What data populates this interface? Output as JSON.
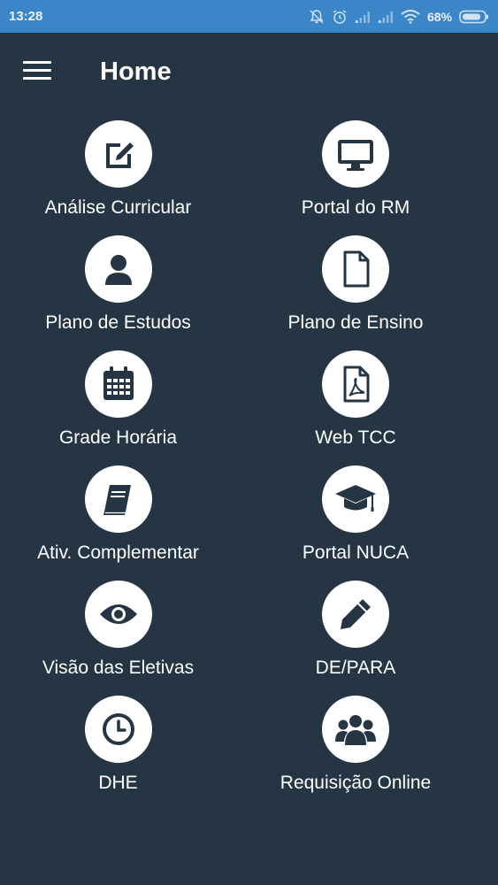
{
  "status_bar": {
    "time": "13:28",
    "battery": "68%",
    "icons": [
      "mute-bell-icon",
      "alarm-icon",
      "signal-icon",
      "signal-icon",
      "wifi-icon",
      "battery-icon"
    ]
  },
  "header": {
    "title": "Home",
    "menu_icon": "hamburger-menu-icon"
  },
  "menu_items": [
    {
      "label": "Análise Curricular",
      "icon": "edit-square-icon"
    },
    {
      "label": "Portal do RM",
      "icon": "desktop-monitor-icon"
    },
    {
      "label": "Plano de Estudos",
      "icon": "user-icon"
    },
    {
      "label": "Plano de Ensino",
      "icon": "document-icon"
    },
    {
      "label": "Grade Horária",
      "icon": "calendar-icon"
    },
    {
      "label": "Web TCC",
      "icon": "pdf-file-icon"
    },
    {
      "label": "Ativ. Complementar",
      "icon": "book-icon"
    },
    {
      "label": "Portal NUCA",
      "icon": "graduation-cap-icon"
    },
    {
      "label": "Visão das Eletivas",
      "icon": "eye-icon"
    },
    {
      "label": "DE/PARA",
      "icon": "pencil-icon"
    },
    {
      "label": "DHE",
      "icon": "clock-icon"
    },
    {
      "label": "Requisição Online",
      "icon": "users-group-icon"
    }
  ],
  "colors": {
    "background": "#263544",
    "status_bar": "#3a86c8",
    "icon_circle": "#ffffff",
    "icon_fill": "#263544"
  }
}
